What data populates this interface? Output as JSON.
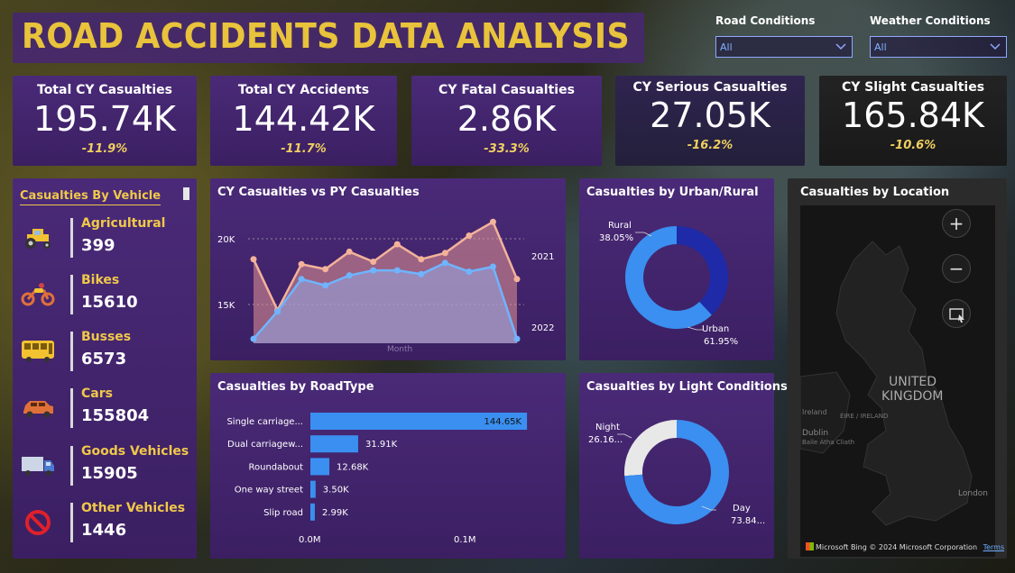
{
  "header": {
    "title": "ROAD ACCIDENTS DATA ANALYSIS",
    "title_color": "#e8c33b"
  },
  "filters": [
    {
      "label": "Road Conditions",
      "value": "All"
    },
    {
      "label": "Weather Conditions",
      "value": "All"
    }
  ],
  "kpis": [
    {
      "label": "Total CY Casualties",
      "value": "195.74K",
      "delta": "-11.9%"
    },
    {
      "label": "Total CY Accidents",
      "value": "144.42K",
      "delta": "-11.7%"
    },
    {
      "label": "CY Fatal Casualties",
      "value": "2.86K",
      "delta": "-33.3%"
    },
    {
      "label": "CY Serious Casualties",
      "value": "27.05K",
      "delta": "-16.2%"
    },
    {
      "label": "CY Slight Casualties",
      "value": "165.84K",
      "delta": "-10.6%"
    }
  ],
  "vehicles": {
    "title": "Casualties By Vehicle",
    "items": [
      {
        "name": "Agricultural",
        "value": "399",
        "icon": "tractor-icon"
      },
      {
        "name": "Bikes",
        "value": "15610",
        "icon": "motorbike-icon"
      },
      {
        "name": "Busses",
        "value": "6573",
        "icon": "bus-icon"
      },
      {
        "name": "Cars",
        "value": "155804",
        "icon": "car-icon"
      },
      {
        "name": "Goods Vehicles",
        "value": "15905",
        "icon": "truck-icon"
      },
      {
        "name": "Other Vehicles",
        "value": "1446",
        "icon": "prohibited-icon"
      }
    ]
  },
  "charts": {
    "cy_vs_py": {
      "title": "CY Casualties vs PY Casualties",
      "y_ticks": [
        "20K",
        "15K"
      ],
      "xlabel": "Month",
      "series_labels": [
        "2021",
        "2022"
      ]
    },
    "roadtype": {
      "title": "Casualties by RoadType",
      "categories": [
        "Single carriage...",
        "Dual carriagew...",
        "Roundabout",
        "One way street",
        "Slip road"
      ],
      "value_labels": [
        "144.65K",
        "31.91K",
        "12.68K",
        "3.50K",
        "2.99K"
      ],
      "x_ticks": [
        "0.0M",
        "0.1M"
      ]
    },
    "urban_rural": {
      "title": "Casualties by Urban/Rural",
      "labels": [
        {
          "name": "Rural",
          "pct": "38.05%"
        },
        {
          "name": "Urban",
          "pct": "61.95%"
        }
      ]
    },
    "light": {
      "title": "Casualties by Light Conditions",
      "labels": [
        {
          "name": "Night",
          "pct": "26.16..."
        },
        {
          "name": "Day",
          "pct": "73.84..."
        }
      ]
    },
    "location": {
      "title": "Casualties by Location",
      "country_label": "UNITED KINGDOM",
      "place_labels": [
        "Ireland",
        "Dublin",
        "Baile Átha Cliath",
        "ÉIRE / IRELAND",
        "London"
      ],
      "zoom_in": "+",
      "zoom_out": "−",
      "attribution": "Microsoft Bing",
      "copyright": "© 2024 Microsoft Corporation",
      "terms": "Terms"
    }
  },
  "colors": {
    "panel": "#4a2a78",
    "accent_gold": "#f0c84a",
    "blue": "#3a8ff0",
    "navy": "#1e2aa8",
    "salmon": "#f3b39a",
    "light_grey": "#e8e8e8"
  },
  "chart_data": [
    {
      "type": "area",
      "title": "CY Casualties vs PY Casualties",
      "xlabel": "Month",
      "ylabel": "",
      "x": [
        1,
        2,
        3,
        4,
        5,
        6,
        7,
        8,
        9,
        10,
        11,
        12
      ],
      "ylim": [
        12000,
        22500
      ],
      "series": [
        {
          "name": "2021",
          "values": [
            18900,
            14800,
            18500,
            18100,
            19500,
            18700,
            20100,
            18900,
            19400,
            20800,
            21900,
            17300
          ]
        },
        {
          "name": "2022",
          "values": [
            12500,
            14700,
            17300,
            16800,
            17600,
            18000,
            18000,
            17700,
            18600,
            17900,
            18300,
            12500
          ]
        }
      ]
    },
    {
      "type": "bar",
      "title": "Casualties by RoadType",
      "categories": [
        "Single carriage...",
        "Dual carriagew...",
        "Roundabout",
        "One way street",
        "Slip road"
      ],
      "values": [
        144650,
        31910,
        12680,
        3500,
        2990
      ],
      "xlim": [
        0,
        150000
      ]
    },
    {
      "type": "pie",
      "title": "Casualties by Urban/Rural",
      "categories": [
        "Rural",
        "Urban"
      ],
      "values": [
        38.05,
        61.95
      ]
    },
    {
      "type": "pie",
      "title": "Casualties by Light Conditions",
      "categories": [
        "Night",
        "Day"
      ],
      "values": [
        26.16,
        73.84
      ]
    }
  ]
}
